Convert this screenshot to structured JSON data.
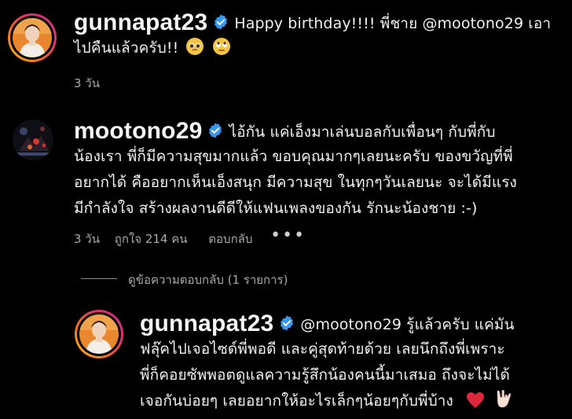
{
  "comments": [
    {
      "username": "gunnapat23",
      "text_line1": "Happy birthday!!!! พี่ชาย @mootono29 เอา",
      "text_line2": "ไปคืนแล้วครับ!!",
      "emoji_a": "pleading-face",
      "emoji_b": "rolling-eyes-face",
      "time": "3 วัน"
    },
    {
      "username": "mootono29",
      "text_line1": "ไอ้กัน แค่เอ็งมาเล่นบอลกับเพื่อนๆ กับพี่กับ",
      "text_line2": "น้องเรา พี่ก็มีความสุขมากแล้ว ขอบคุณมากๆเลยนะครับ ของขวัญที่พี่",
      "text_line3": "อยากได้ คืออยากเห็นเอ็งสนุก มีความสุข ในทุกๆวันเลยนะ จะได้มีแรง",
      "text_line4": "มีกำลังใจ สร้างผลงานดีดีให้แฟนเพลงของกัน รักนะน้องชาย :-)",
      "time": "3 วัน",
      "likes": "ถูกใจ 214 คน",
      "reply": "ตอบกลับ",
      "more": "•••"
    }
  ],
  "replies_toggle": "ดูข้อความตอบกลับ (1 รายการ)",
  "reply_comment": {
    "username": "gunnapat23",
    "text_line1": "@mootono29 รู้แล้วครับ แค่มัน",
    "text_line2": "ฟลุ๊คไปเจอไซด์พี่พอดี และคู่สุดท้ายด้วย เลยนึกถึงพี่เพราะ",
    "text_line3": "พี่ก็คอยซัพพอตดูแลความรู้สึกน้องคนนี้มาเสมอ ถึงจะไม่ได้",
    "text_line4": "เจอกันบ่อยๆ เลยอยากให้อะไรเล็กๆน้อยๆกับพี่บ้าง",
    "emoji_a": "red-heart",
    "emoji_b": "love-you-gesture"
  },
  "colors": {
    "background": "#000000",
    "verified_blue": "#3897f0",
    "meta_gray": "#a8a8a8"
  }
}
